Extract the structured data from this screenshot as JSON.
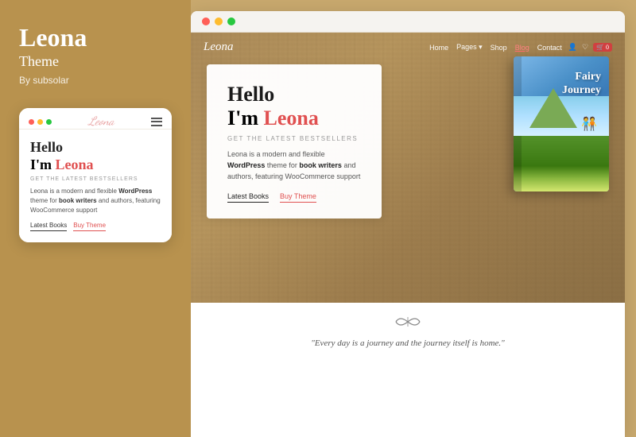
{
  "leftPanel": {
    "title": "Leona",
    "subtitle": "Theme",
    "by": "By subsolar"
  },
  "mobileMockup": {
    "logoText": "Leona",
    "hello": "Hello",
    "im": "I'm",
    "name": "Leona",
    "tagline": "GET THE LATEST BESTSELLERS",
    "description": "Leona is a modern and flexible",
    "descWordPress": "WordPress",
    "descMiddle": "theme for",
    "descBookWriters": "book writers",
    "descEnd": "and authors, featuring WooCommerce support",
    "btn1": "Latest Books",
    "btn2": "Buy Theme"
  },
  "browserWindow": {
    "dots": [
      "red",
      "yellow",
      "green"
    ],
    "nav": {
      "logo": "Leona",
      "links": [
        "Home",
        "Pages",
        "Shop",
        "Blog",
        "Contact"
      ]
    },
    "hero": {
      "hello": "Hello",
      "im": "I'm",
      "name": "Leona",
      "tagline": "GET THE LATEST BESTSELLERS",
      "description": "Leona is a modern and flexible",
      "descWordPress": "WordPress",
      "descMiddle": "theme for",
      "descBookWriters": "book writers",
      "descEnd": "and authors, featuring WooCommerce support",
      "btn1": "Latest Books",
      "btn2": "Buy Theme"
    },
    "book": {
      "title": "Fairy\nJourney"
    },
    "quote": "\"Every day is a journey and the journey itself is home.\""
  }
}
